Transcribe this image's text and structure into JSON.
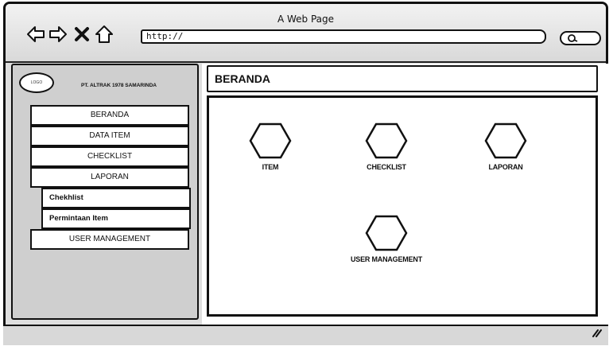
{
  "window": {
    "title": "A Web Page"
  },
  "browser": {
    "url": "http://"
  },
  "icons": {
    "back": "back-arrow-icon",
    "forward": "forward-arrow-icon",
    "stop": "close-icon",
    "home": "home-icon",
    "search": "search-icon",
    "resize": "resize-grip-icon"
  },
  "sidebar": {
    "logo": "LOGO",
    "company": "PT. ALTRAK 1978 SAMARINDA",
    "menu": [
      {
        "label": "BERANDA"
      },
      {
        "label": "DATA ITEM"
      },
      {
        "label": "CHECKLIST"
      },
      {
        "label": "LAPORAN"
      }
    ],
    "submenu": [
      {
        "label": "Chekhlist"
      },
      {
        "label": "Permintaan Item"
      }
    ],
    "user_management": "USER MANAGEMENT"
  },
  "main": {
    "page_title": "BERANDA",
    "tiles": [
      {
        "label": "ITEM"
      },
      {
        "label": "CHECKLIST"
      },
      {
        "label": "LAPORAN"
      },
      {
        "label": "USER MANAGEMENT"
      }
    ]
  }
}
